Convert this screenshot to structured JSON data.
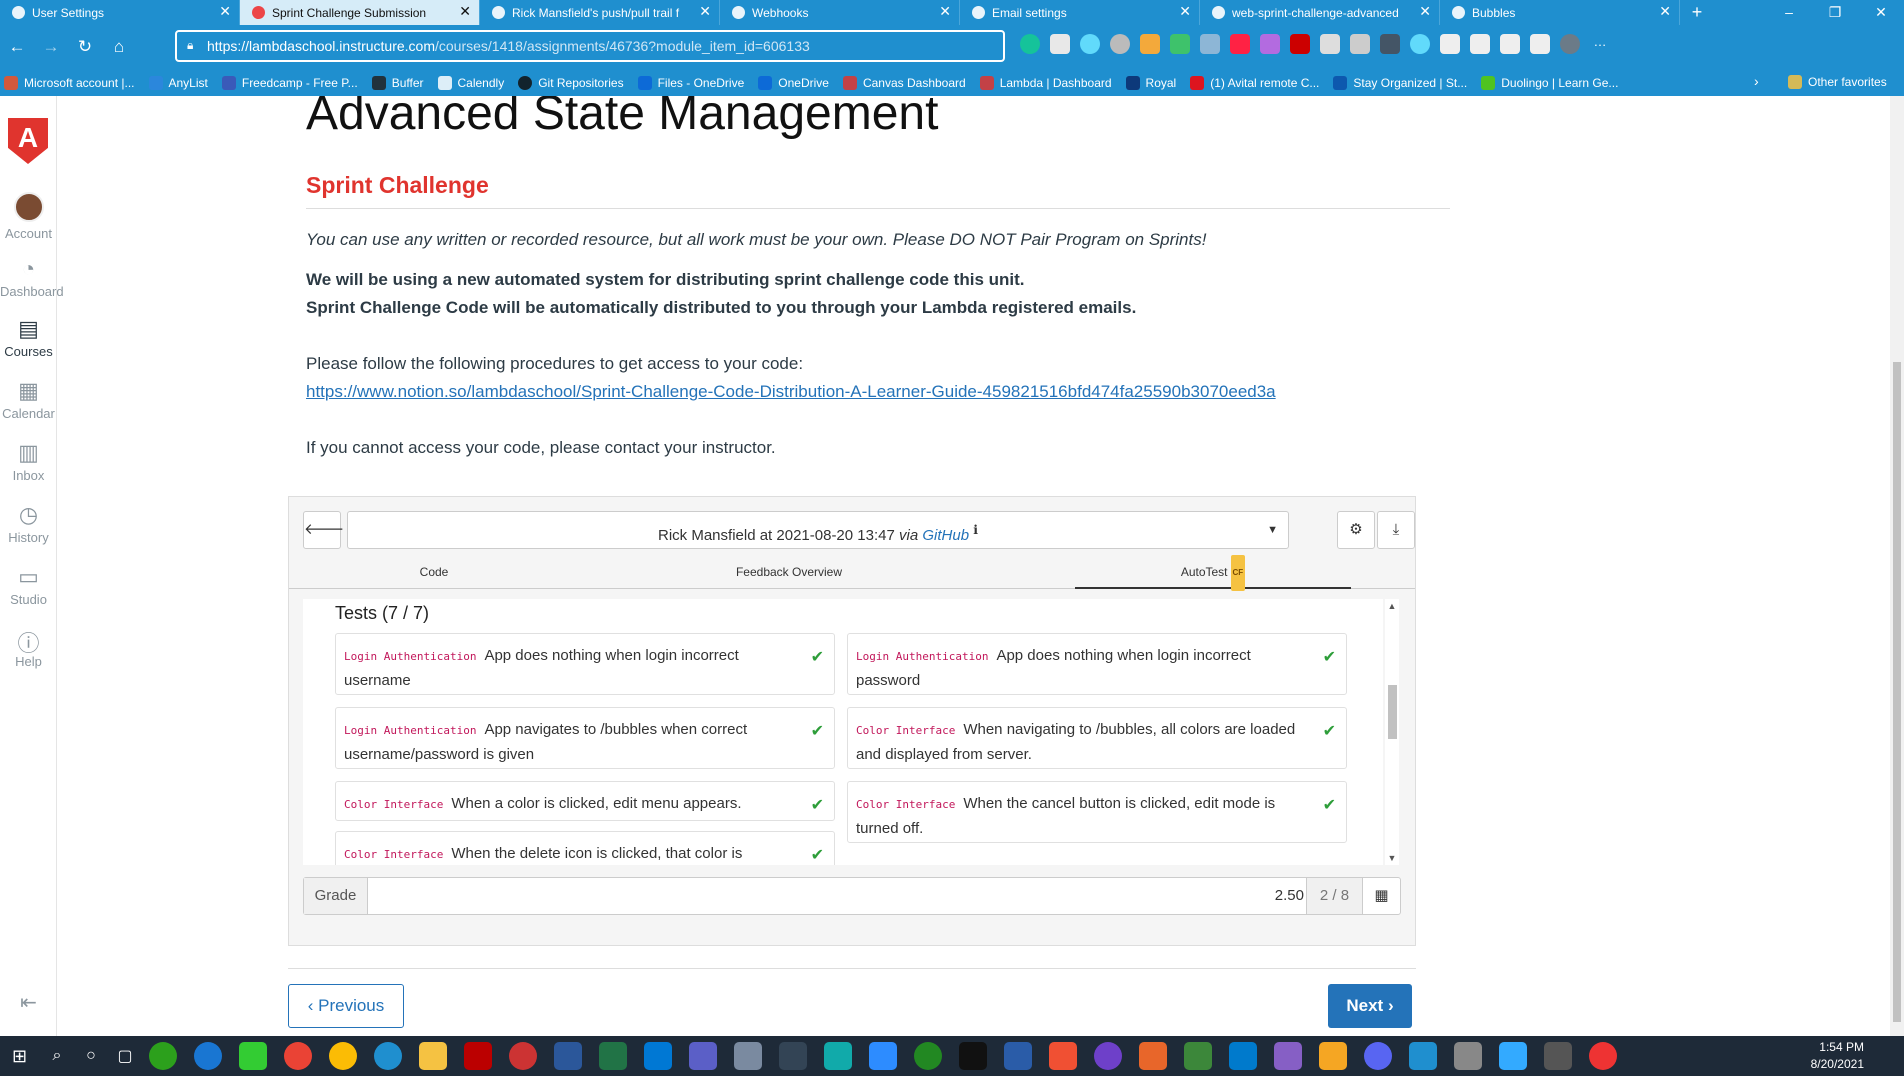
{
  "browser": {
    "tabs": [
      {
        "label": "User Settings"
      },
      {
        "label": "Sprint Challenge Submission"
      },
      {
        "label": "Rick Mansfield's push/pull trail f"
      },
      {
        "label": "Webhooks"
      },
      {
        "label": "Email settings"
      },
      {
        "label": "web-sprint-challenge-advanced"
      },
      {
        "label": "Bubbles"
      }
    ],
    "url_host": "https://lambdaschool.instructure.com",
    "url_path": "/courses/1418/assignments/46736?module_item_id=606133",
    "bookmarks": [
      "Microsoft account |...",
      "AnyList",
      "Freedcamp - Free P...",
      "Buffer",
      "Calendly",
      "Git Repositories",
      "Files - OneDrive",
      "OneDrive",
      "Canvas Dashboard",
      "Lambda | Dashboard",
      "Royal",
      "(1) Avital remote C...",
      "Stay Organized | St...",
      "Duolingo | Learn Ge..."
    ],
    "other_favorites": "Other favorites"
  },
  "sidebar": {
    "logo": "A",
    "items": [
      {
        "label": "Account",
        "icon": "avatar"
      },
      {
        "label": "Dashboard",
        "icon": "dashboard-icon"
      },
      {
        "label": "Courses",
        "icon": "book-icon"
      },
      {
        "label": "Calendar",
        "icon": "calendar-icon"
      },
      {
        "label": "Inbox",
        "icon": "inbox-icon"
      },
      {
        "label": "History",
        "icon": "clock-icon"
      },
      {
        "label": "Studio",
        "icon": "studio-icon"
      },
      {
        "label": "Help",
        "icon": "help-icon"
      }
    ]
  },
  "page": {
    "title": "Advanced State Management",
    "section": "Sprint Challenge",
    "note_italic": "You can use any written or recorded resource, but all work must be your own. Please DO NOT Pair Program on Sprints!",
    "bold_line1": "We will be using a new automated system for distributing sprint challenge code this unit.",
    "bold_line2": "Sprint Challenge Code will be automatically distributed to you through your Lambda registered emails.",
    "follow": "Please follow the following procedures to get access to your code:",
    "link": "https://www.notion.so/lambdaschool/Sprint-Challenge-Code-Distribution-A-Learner-Guide-459821516bfd474fa25590b3070eed3a",
    "contact": "If you cannot access your code, please contact your instructor."
  },
  "submission": {
    "author_line": "Rick Mansfield at 2021-08-20 13:47",
    "via": "via",
    "source": "GitHub",
    "tabs": [
      "Code",
      "Feedback Overview",
      "AutoTest"
    ],
    "autotest_badge": "CF",
    "tests_header": "Tests (7 / 7)",
    "tests": [
      {
        "tag": "Login Authentication",
        "text": "App does nothing when login incorrect username"
      },
      {
        "tag": "Login Authentication",
        "text": "App does nothing when login incorrect password"
      },
      {
        "tag": "Login Authentication",
        "text": "App navigates to /bubbles when correct username/password is given"
      },
      {
        "tag": "Color Interface",
        "text": "When navigating to /bubbles, all colors are loaded and displayed from server."
      },
      {
        "tag": "Color Interface",
        "text": "When a color is clicked, edit menu appears."
      },
      {
        "tag": "Color Interface",
        "text": "When the cancel button is clicked, edit mode is turned off."
      },
      {
        "tag": "Color Interface",
        "text": "When the delete icon is clicked, that color is"
      }
    ],
    "grade_label": "Grade",
    "grade_value": "2.50",
    "points": "2 / 8"
  },
  "footer": {
    "previous": "‹ Previous",
    "next": "Next ›"
  },
  "taskbar": {
    "time": "1:54 PM",
    "date": "8/20/2021"
  }
}
